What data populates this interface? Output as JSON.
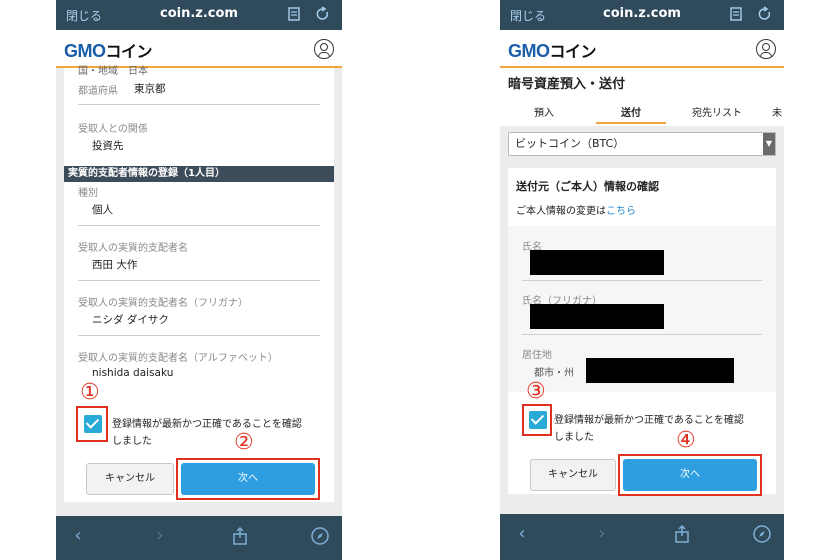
{
  "browser": {
    "close_label": "閉じる",
    "url": "coin.z.com"
  },
  "logo": {
    "gmo": "GMO",
    "coin": "コイン"
  },
  "left": {
    "top_cut_text": "国・地域　日本",
    "prefecture_label": "都道府県",
    "prefecture_value": "東京都",
    "relation_label": "受取人との関係",
    "relation_value": "投資先",
    "section_title": "実質的支配者情報の登録（1人目）",
    "type_label": "種別",
    "type_value": "個人",
    "owner_name_label": "受取人の実質的支配者名",
    "owner_name_value": "西田 大作",
    "owner_kana_label": "受取人の実質的支配者名（フリガナ）",
    "owner_kana_value": "ニシダ ダイサク",
    "owner_alpha_label": "受取人の実質的支配者名（アルファベット）",
    "owner_alpha_value": "nishida daisaku",
    "confirm_line1": "登録情報が最新かつ正確であることを確認",
    "confirm_line2": "しました",
    "cancel_label": "キャンセル",
    "next_label": "次へ",
    "marker_check": "①",
    "marker_next": "②"
  },
  "right": {
    "page_title": "暗号資産預入・送付",
    "tabs": [
      "預入",
      "送付",
      "宛先リスト",
      "未"
    ],
    "active_tab": "送付",
    "select_value": "ビットコイン（BTC）",
    "card_title": "送付元（ご本人）情報の確認",
    "change_text": "ご本人情報の変更は",
    "change_link": "こちら",
    "name_label": "氏名",
    "kana_label": "氏名（フリガナ）",
    "address_label": "居住地",
    "city_label": "都市・州",
    "confirm_line1": "登録情報が最新かつ正確であることを確認",
    "confirm_line2": "しました",
    "cancel_label": "キャンセル",
    "next_label": "次へ",
    "marker_check": "③",
    "marker_next": "④"
  },
  "icons": [
    "back-arrow-icon",
    "forward-arrow-icon",
    "share-icon",
    "compass-icon",
    "bookmark-icon",
    "reload-icon",
    "user-icon",
    "checkbox-checked-icon"
  ],
  "colors": {
    "brand_blue": "#1a5ea8",
    "accent_orange": "#f0a63a",
    "button_blue": "#2e9ee0",
    "check_blue": "#28a9d6",
    "highlight_red": "#e0301e",
    "toolbar": "#2f4a5a"
  }
}
